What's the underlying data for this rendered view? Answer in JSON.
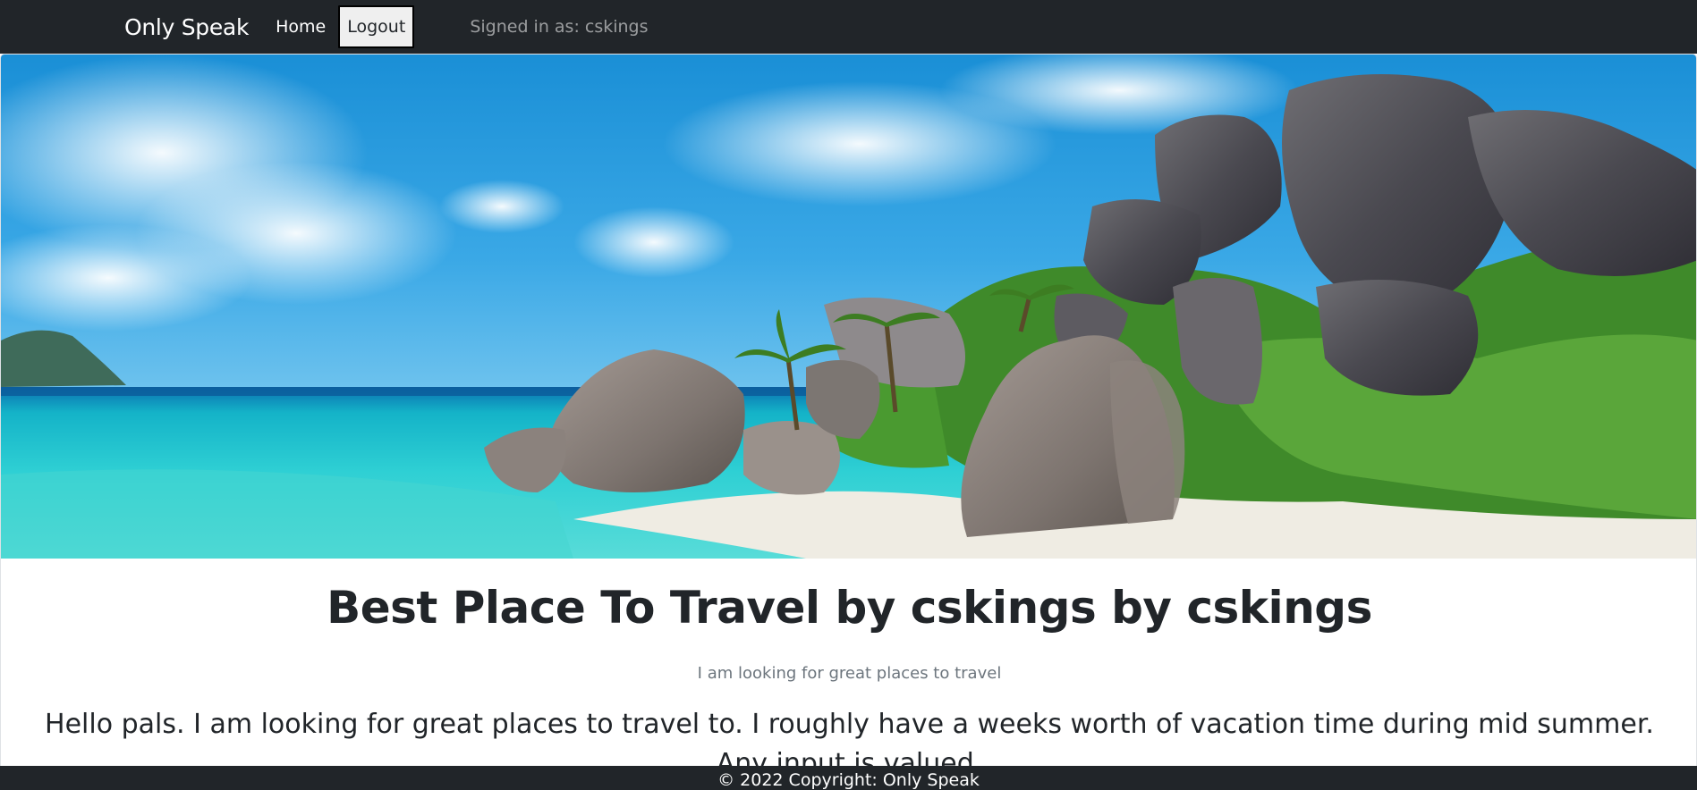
{
  "navbar": {
    "brand": "Only Speak",
    "home_label": "Home",
    "logout_label": "Logout",
    "signed_in_text": "Signed in as: cskings"
  },
  "post": {
    "title": "Best Place To Travel by cskings by cskings",
    "subtitle": "I am looking for great places to travel",
    "body": "Hello pals. I am looking for great places to travel to. I roughly have a weeks worth of vacation time during mid summer. Any input is valued."
  },
  "footer": {
    "copyright": "© 2022 Copyright: Only Speak"
  },
  "colors": {
    "navbar_bg": "#212529",
    "text_dark": "#212529",
    "text_muted": "#6c757d"
  }
}
